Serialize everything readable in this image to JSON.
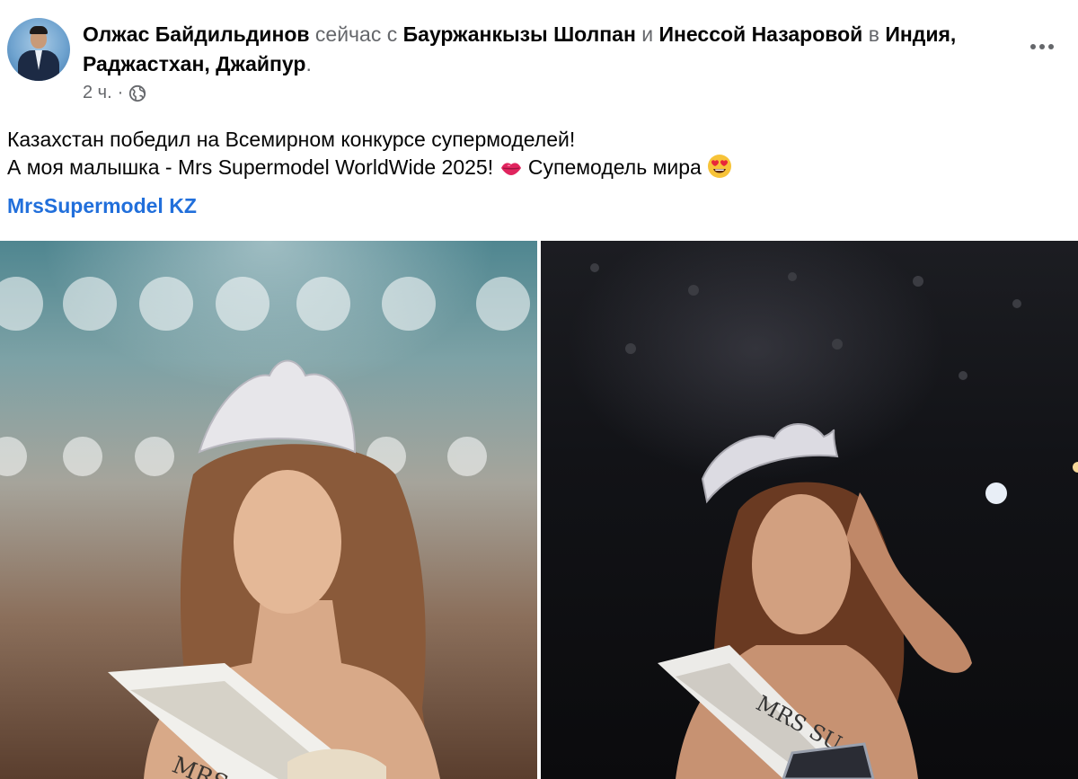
{
  "post": {
    "author": "Олжас Байдильдинов",
    "time_word": "сейчас",
    "with_word": "с",
    "tag1": "Бауржанкызы Шолпан",
    "and_word": "и",
    "tag2": "Инессой Назаровой",
    "in_word": "в",
    "location": "Индия, Раджастхан, Джайпур",
    "period": ".",
    "timestamp": "2 ч.",
    "separator": "·",
    "audience_icon": "globe-icon",
    "line1": "Казахстан победил на Всемирном конкурсе супермоделей!",
    "line2": "А моя малышка - Mrs Supermodel WorldWide 2025!",
    "emoji1": "kiss-lips-icon",
    "line2_tail": "Супемодель мира",
    "emoji2": "heart-eyes-icon",
    "hashtag": "MrsSupermodel KZ",
    "photos": [
      {
        "sash_text": "MRS S"
      },
      {
        "sash_text": "MRS SU"
      }
    ]
  },
  "colors": {
    "primary_text": "#050505",
    "secondary_text": "#65676b",
    "link": "#216fdb"
  }
}
